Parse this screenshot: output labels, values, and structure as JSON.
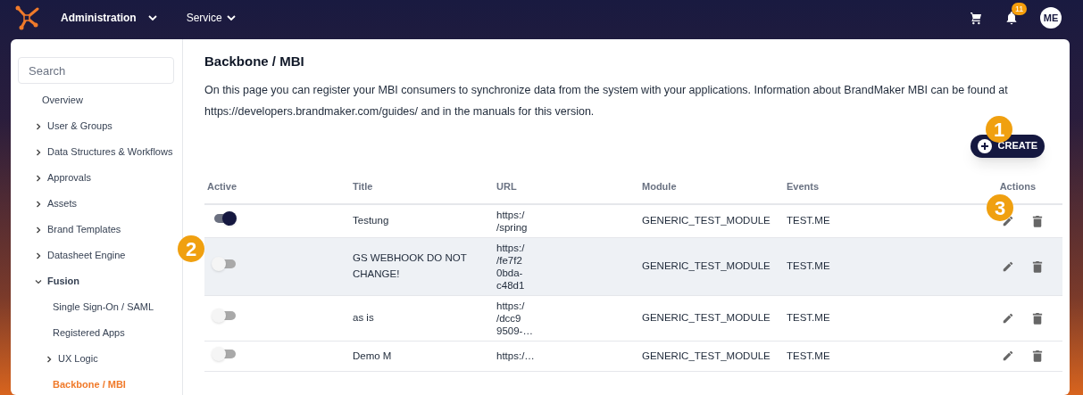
{
  "topbar": {
    "menus": [
      {
        "label": "Administration",
        "bold": true
      },
      {
        "label": "Service",
        "bold": false
      }
    ],
    "notification_count": "11",
    "avatar": "ME"
  },
  "sidebar": {
    "search": {
      "placeholder": "Search"
    },
    "items": [
      {
        "label": "Overview",
        "expandable": false,
        "expanded": false,
        "selected": false
      },
      {
        "label": "User & Groups",
        "expandable": true,
        "expanded": false,
        "selected": false
      },
      {
        "label": "Data Structures & Workflows",
        "expandable": true,
        "expanded": false,
        "selected": false
      },
      {
        "label": "Approvals",
        "expandable": true,
        "expanded": false,
        "selected": false
      },
      {
        "label": "Assets",
        "expandable": true,
        "expanded": false,
        "selected": false
      },
      {
        "label": "Brand Templates",
        "expandable": true,
        "expanded": false,
        "selected": false
      },
      {
        "label": "Datasheet Engine",
        "expandable": true,
        "expanded": false,
        "selected": false
      },
      {
        "label": "Fusion",
        "expandable": true,
        "expanded": true,
        "selected": false,
        "children": [
          {
            "label": "Single Sign-On / SAML",
            "expandable": false,
            "expanded": false,
            "selected": false
          },
          {
            "label": "Registered Apps",
            "expandable": false,
            "expanded": false,
            "selected": false
          },
          {
            "label": "UX Logic",
            "expandable": true,
            "expanded": false,
            "selected": false
          },
          {
            "label": "Backbone / MBI",
            "expandable": false,
            "expanded": false,
            "selected": true
          }
        ]
      }
    ]
  },
  "page": {
    "title": "Backbone / MBI",
    "description": "On this page you can register your MBI consumers to synchronize data from the system with your applications. Information about BrandMaker MBI can be found at https://developers.brandmaker.com/guides/ and in the manuals for this version.",
    "create_button": "CREATE"
  },
  "table": {
    "columns": [
      "Active",
      "Title",
      "URL",
      "Module",
      "Events",
      "Actions"
    ],
    "rows": [
      {
        "active": true,
        "highlighted": false,
        "title": "Testung",
        "url": [
          "https:/",
          "/spring"
        ],
        "module": "GENERIC_TEST_MODULE",
        "events": "TEST.ME"
      },
      {
        "active": false,
        "highlighted": true,
        "title": "GS WEBHOOK DO NOT CHANGE!",
        "url": [
          "https:/",
          "/fe7f2",
          "0bda-",
          "c48d1"
        ],
        "module": "GENERIC_TEST_MODULE",
        "events": "TEST.ME"
      },
      {
        "active": false,
        "highlighted": false,
        "title": "as is",
        "url": [
          "https:/",
          "/dcc9",
          "9509-…"
        ],
        "module": "GENERIC_TEST_MODULE",
        "events": "TEST.ME"
      },
      {
        "active": false,
        "highlighted": false,
        "title": "Demo M",
        "url": [
          "https:/…"
        ],
        "module": "GENERIC_TEST_MODULE",
        "events": "TEST.ME"
      }
    ]
  },
  "callouts": [
    "1",
    "2",
    "3"
  ]
}
